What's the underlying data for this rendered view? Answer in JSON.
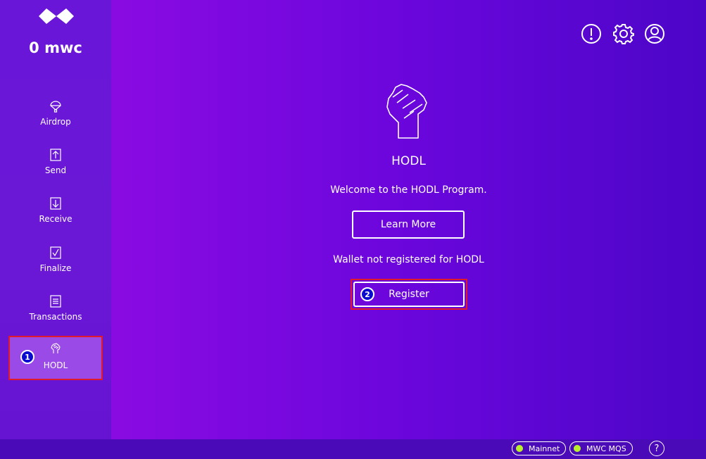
{
  "sidebar": {
    "balance": "0 mwc",
    "items": [
      {
        "label": "Airdrop",
        "icon": "parachute-icon"
      },
      {
        "label": "Send",
        "icon": "send-arrow-up-icon"
      },
      {
        "label": "Receive",
        "icon": "receive-arrow-down-icon"
      },
      {
        "label": "Finalize",
        "icon": "finalize-check-icon"
      },
      {
        "label": "Transactions",
        "icon": "document-list-icon"
      },
      {
        "label": "HODL",
        "icon": "fist-icon",
        "active": true
      }
    ]
  },
  "header": {
    "icons": [
      "info-icon",
      "gear-icon",
      "user-account-icon"
    ]
  },
  "main": {
    "title": "HODL",
    "welcome": "Welcome to the HODL Program.",
    "learn_more_label": "Learn More",
    "status_text": "Wallet not registered for HODL",
    "register_label": "Register"
  },
  "annotations": {
    "marker1": "1",
    "marker2": "2"
  },
  "statusbar": {
    "network_label": "Mainnet",
    "mqs_label": "MWC MQS",
    "help_label": "?",
    "indicator_color": "#b8f02a"
  },
  "colors": {
    "highlight_border": "#e01a2a",
    "active_item_bg": "#9a4ae6",
    "marker_bg": "#0a0ad0"
  }
}
